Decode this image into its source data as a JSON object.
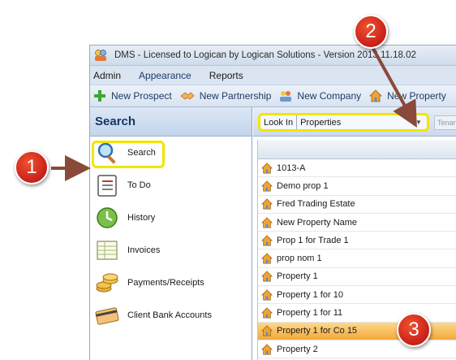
{
  "window": {
    "title": "DMS - Licensed to Logican by Logican Solutions - Version 2013.11.18.02"
  },
  "menu": [
    "Admin",
    "Appearance",
    "Reports"
  ],
  "toolbar": {
    "new_prospect": "New Prospect",
    "new_partnership": "New Partnership",
    "new_company": "New Company",
    "new_property": "New Property"
  },
  "sidebar": {
    "title": "Search",
    "items": [
      {
        "label": "Search",
        "icon": "magnifier-icon"
      },
      {
        "label": "To Do",
        "icon": "todo-list-icon"
      },
      {
        "label": "History",
        "icon": "history-icon"
      },
      {
        "label": "Invoices",
        "icon": "invoice-icon"
      },
      {
        "label": "Payments/Receipts",
        "icon": "coins-icon"
      },
      {
        "label": "Client Bank Accounts",
        "icon": "bank-card-icon"
      }
    ]
  },
  "filter": {
    "look_in_label": "Look In",
    "look_in_value": "Properties",
    "tenant_partial": "Tenan"
  },
  "results": [
    "1013-A",
    "Demo prop 1",
    "Fred Trading Estate",
    "New Property Name",
    "Prop 1 for Trade 1",
    "prop nom 1",
    "Property 1",
    "Property 1 for 10",
    "Property 1 for 11",
    "Property 1 for Co 15",
    "Property 2"
  ],
  "selected_index": 9,
  "callouts": [
    "1",
    "2",
    "3"
  ],
  "colors": {
    "highlight_box": "#f2e500",
    "callout_red": "#c8201a",
    "selection": "#f5a73b",
    "header_blue": "#15365f"
  }
}
